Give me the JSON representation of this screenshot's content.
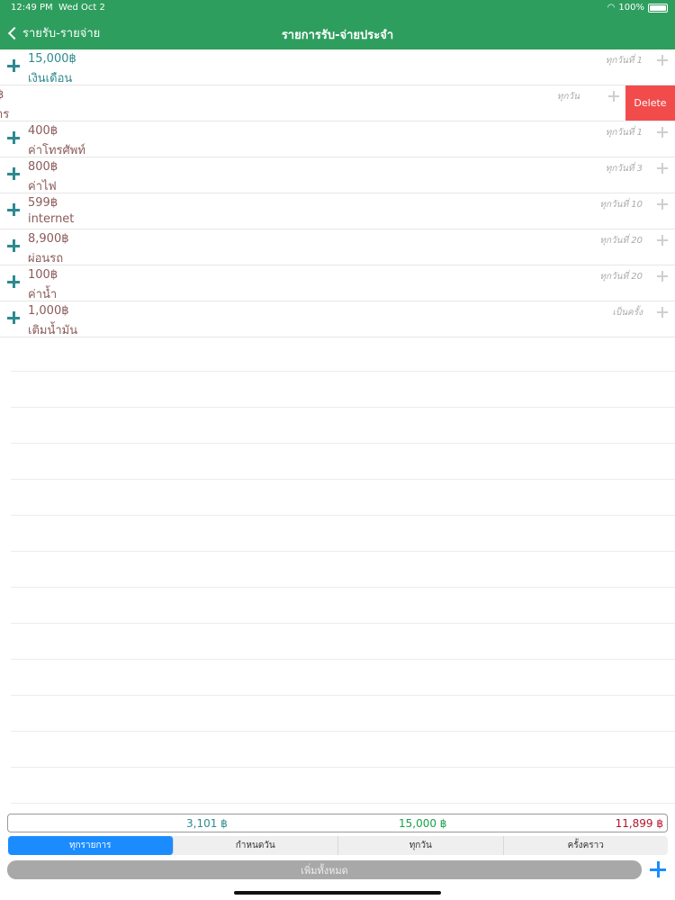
{
  "status": {
    "time": "12:49 PM",
    "date": "Wed Oct 2",
    "battery": "100%"
  },
  "nav": {
    "back_label": "รายรับ-รายจ่าย",
    "title": "รายการรับ-จ่ายประจำ"
  },
  "rows": [
    {
      "amount": "15,000฿",
      "name": "เงินเดือน",
      "freq": "ทุกวันที่ 1",
      "type": "income"
    },
    {
      "amount": "฿",
      "name": "าร",
      "freq": "ทุกวัน",
      "type": "expense",
      "swiped": true,
      "delete_label": "Delete"
    },
    {
      "amount": "400฿",
      "name": "ค่าโทรศัพท์",
      "freq": "ทุกวันที่ 1",
      "type": "expense"
    },
    {
      "amount": "800฿",
      "name": "ค่าไฟ",
      "freq": "ทุกวันที่ 3",
      "type": "expense"
    },
    {
      "amount": "599฿",
      "name": "internet",
      "freq": "ทุกวันที่ 10",
      "type": "expense"
    },
    {
      "amount": "8,900฿",
      "name": "ผ่อนรถ",
      "freq": "ทุกวันที่ 20",
      "type": "expense"
    },
    {
      "amount": "100฿",
      "name": "ค่าน้ำ",
      "freq": "ทุกวันที่ 20",
      "type": "expense"
    },
    {
      "amount": "1,000฿",
      "name": "เติมน้ำมัน",
      "freq": "เป็นครั้ง",
      "type": "expense"
    }
  ],
  "totals": {
    "expense": "3,101 ฿",
    "income": "15,000 ฿",
    "balance": "11,899 ฿"
  },
  "filters": [
    {
      "label": "ทุกรายการ",
      "active": true
    },
    {
      "label": "กำหนดวัน",
      "active": false
    },
    {
      "label": "ทุกวัน",
      "active": false
    },
    {
      "label": "ครั้งคราว",
      "active": false
    }
  ],
  "add_all_label": "เพิ่มทั้งหมด",
  "colors": {
    "header": "#2e9e5e",
    "accent": "#1a8cff",
    "delete": "#f24b4b",
    "income": "#2e8a8f",
    "expense": "#8c5a5a"
  }
}
